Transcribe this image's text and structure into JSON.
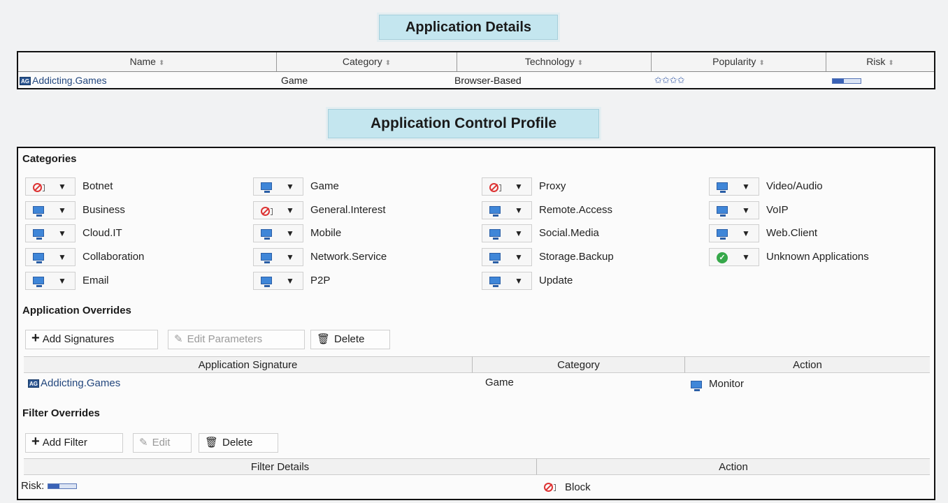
{
  "details": {
    "title": "Application Details",
    "columns": [
      "Name",
      "Category",
      "Technology",
      "Popularity",
      "Risk"
    ],
    "row": {
      "name": "Addicting.Games",
      "category": "Game",
      "technology": "Browser-Based",
      "popularity_stars": "✩✩✩✩",
      "popularity_rating": 4,
      "risk_level": 2
    }
  },
  "profile": {
    "title": "Application Control Profile",
    "categories_title": "Categories",
    "categories": [
      {
        "label": "Botnet",
        "action_icon": "block-icon"
      },
      {
        "label": "Business",
        "action_icon": "monitor-icon"
      },
      {
        "label": "Cloud.IT",
        "action_icon": "monitor-icon"
      },
      {
        "label": "Collaboration",
        "action_icon": "monitor-icon"
      },
      {
        "label": "Email",
        "action_icon": "monitor-icon"
      },
      {
        "label": "Game",
        "action_icon": "monitor-icon"
      },
      {
        "label": "General.Interest",
        "action_icon": "block-icon"
      },
      {
        "label": "Mobile",
        "action_icon": "monitor-icon"
      },
      {
        "label": "Network.Service",
        "action_icon": "monitor-icon"
      },
      {
        "label": "P2P",
        "action_icon": "monitor-icon"
      },
      {
        "label": "Proxy",
        "action_icon": "block-icon"
      },
      {
        "label": "Remote.Access",
        "action_icon": "monitor-icon"
      },
      {
        "label": "Social.Media",
        "action_icon": "monitor-icon"
      },
      {
        "label": "Storage.Backup",
        "action_icon": "monitor-icon"
      },
      {
        "label": "Update",
        "action_icon": "monitor-icon"
      },
      {
        "label": "Video/Audio",
        "action_icon": "monitor-icon"
      },
      {
        "label": "VoIP",
        "action_icon": "monitor-icon"
      },
      {
        "label": "Web.Client",
        "action_icon": "monitor-icon"
      },
      {
        "label": "Unknown Applications",
        "action_icon": "allow-icon"
      }
    ],
    "app_overrides": {
      "title": "Application Overrides",
      "add_label": "Add Signatures",
      "edit_label": "Edit Parameters",
      "delete_label": "Delete",
      "columns": [
        "Application Signature",
        "Category",
        "Action"
      ],
      "row": {
        "signature": "Addicting.Games",
        "category": "Game",
        "action": "Monitor"
      }
    },
    "filter_overrides": {
      "title": "Filter Overrides",
      "add_label": "Add Filter",
      "edit_label": "Edit",
      "delete_label": "Delete",
      "columns": [
        "Filter Details",
        "Action"
      ],
      "row": {
        "details_label": "Risk:",
        "risk_level": 2,
        "action": "Block"
      }
    }
  },
  "colors": {
    "banner": "#c4e6ef",
    "monitor": "#3f86d8",
    "block": "#dd3333",
    "allow": "#36a84a"
  }
}
